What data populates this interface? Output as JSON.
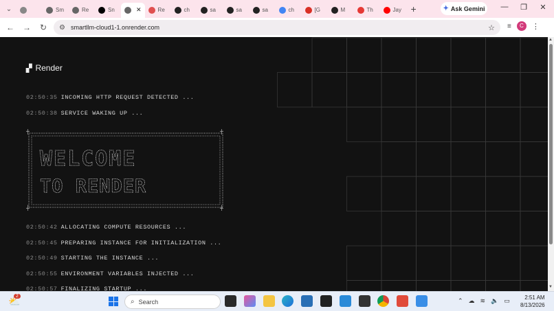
{
  "browser": {
    "tabs": [
      {
        "label": "",
        "icon": "globe-icon",
        "color": "#888888"
      },
      {
        "label": "Sm",
        "icon": "globe-icon",
        "color": "#666666"
      },
      {
        "label": "Re",
        "icon": "globe-icon",
        "color": "#666666"
      },
      {
        "label": "Sn",
        "icon": "render-icon",
        "color": "#000000"
      },
      {
        "label": "",
        "icon": "globe-icon",
        "color": "#666666",
        "active": true
      },
      {
        "label": "Re",
        "icon": "render-icon",
        "color": "#e05050"
      },
      {
        "label": "ch",
        "icon": "chatgpt-icon",
        "color": "#222222"
      },
      {
        "label": "sa",
        "icon": "github-icon",
        "color": "#222222"
      },
      {
        "label": "sa",
        "icon": "github-icon",
        "color": "#222222"
      },
      {
        "label": "sa",
        "icon": "github-icon",
        "color": "#222222"
      },
      {
        "label": "ch",
        "icon": "google-icon",
        "color": "#4285f4"
      },
      {
        "label": "[G",
        "icon": "gmail-icon",
        "color": "#d93025"
      },
      {
        "label": "M",
        "icon": "github-icon",
        "color": "#222222"
      },
      {
        "label": "Th",
        "icon": "video-icon",
        "color": "#e53935"
      },
      {
        "label": "Jay",
        "icon": "youtube-icon",
        "color": "#ff0000"
      }
    ],
    "new_tab_label": "+",
    "ask_gemini": "Ask Gemini",
    "url": "smartllm-cloud1-1.onrender.com",
    "profile_initial": "C"
  },
  "page": {
    "logo_text": "Render",
    "logs_top": [
      {
        "time": "02:50:35",
        "msg": "INCOMING HTTP REQUEST DETECTED ..."
      },
      {
        "time": "02:50:38",
        "msg": "SERVICE WAKING UP ..."
      }
    ],
    "logs_bottom": [
      {
        "time": "02:50:42",
        "msg": "ALLOCATING COMPUTE RESOURCES ..."
      },
      {
        "time": "02:50:45",
        "msg": "PREPARING INSTANCE FOR INITIALIZATION ..."
      },
      {
        "time": "02:50:49",
        "msg": "STARTING THE INSTANCE ..."
      },
      {
        "time": "02:50:55",
        "msg": "ENVIRONMENT VARIABLES INJECTED ..."
      },
      {
        "time": "02:50:57",
        "msg": "FINALIZING STARTUP ..."
      }
    ],
    "banner_line1": "WELCOME",
    "banner_line2": "TO RENDER",
    "grid_color": "#3a3a3a",
    "text_color": "#d8d8d8"
  },
  "taskbar": {
    "weather_badge": "2",
    "search_placeholder": "Search",
    "chrome_badge": "",
    "time": "2:51 AM",
    "date": "8/13/2026"
  }
}
